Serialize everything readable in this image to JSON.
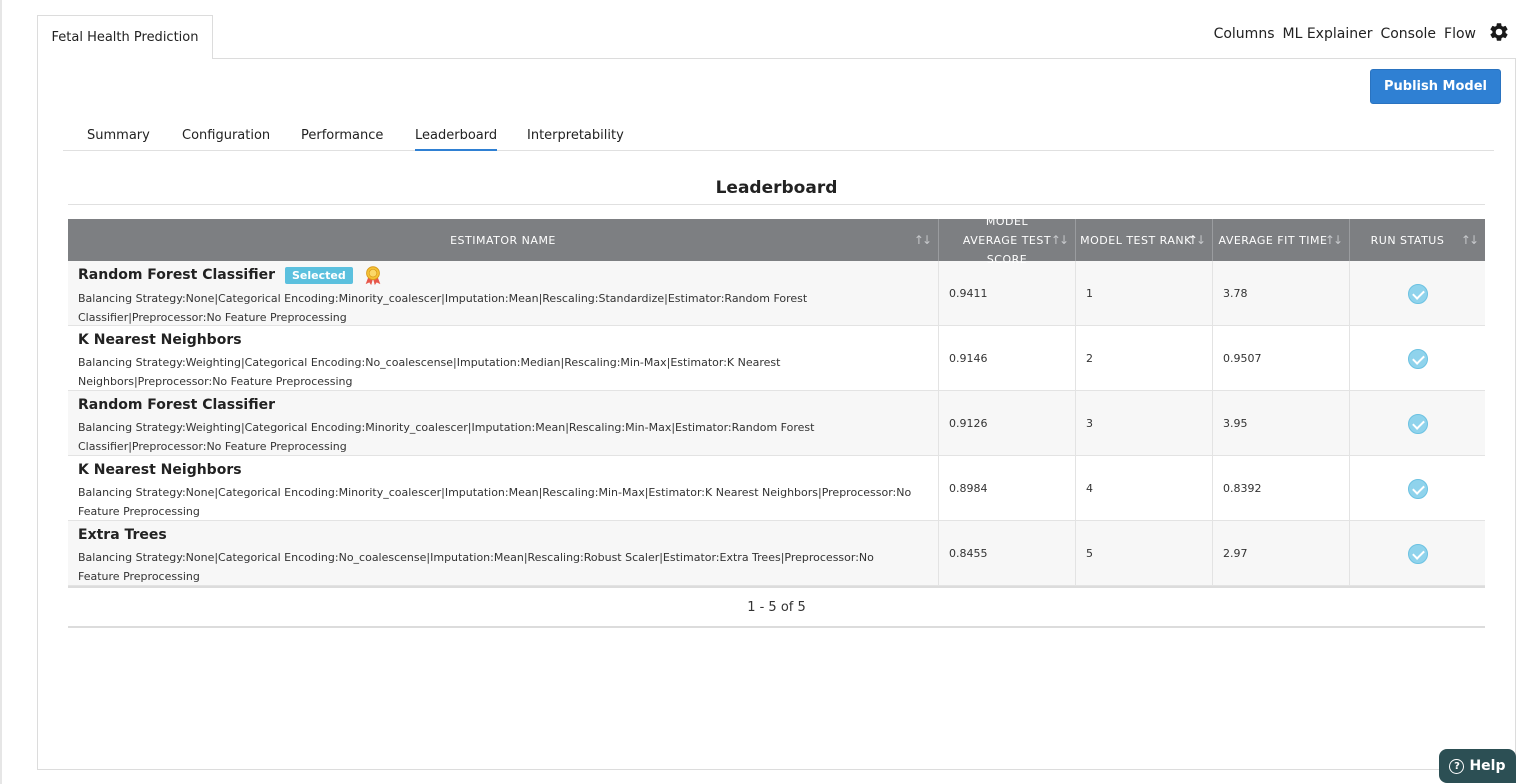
{
  "app": {
    "doc_tab": "Fetal Health Prediction",
    "top_menu": [
      "Columns",
      "ML Explainer",
      "Console",
      "Flow"
    ],
    "gear_icon": "gear-icon"
  },
  "toolbar": {
    "publish_label": "Publish Model"
  },
  "tabs": [
    {
      "label": "Summary",
      "active": false
    },
    {
      "label": "Configuration",
      "active": false
    },
    {
      "label": "Performance",
      "active": false
    },
    {
      "label": "Leaderboard",
      "active": true
    },
    {
      "label": "Interpretability",
      "active": false
    }
  ],
  "leaderboard": {
    "title": "Leaderboard",
    "columns": [
      "ESTIMATOR NAME",
      "MODEL AVERAGE TEST SCORE",
      "MODEL TEST RANK",
      "AVERAGE FIT TIME",
      "RUN STATUS"
    ],
    "selected_badge": "Selected",
    "rows": [
      {
        "name": "Random Forest Classifier",
        "selected": true,
        "description": "Balancing Strategy:None|Categorical Encoding:Minority_coalescer|Imputation:Mean|Rescaling:Standardize|Estimator:Random Forest Classifier|Preprocessor:No Feature Preprocessing",
        "score": "0.9411",
        "rank": "1",
        "fit_time": "3.78",
        "status": "completed"
      },
      {
        "name": "K Nearest Neighbors",
        "selected": false,
        "description": "Balancing Strategy:Weighting|Categorical Encoding:No_coalescense|Imputation:Median|Rescaling:Min-Max|Estimator:K Nearest Neighbors|Preprocessor:No Feature Preprocessing",
        "score": "0.9146",
        "rank": "2",
        "fit_time": "0.9507",
        "status": "completed"
      },
      {
        "name": "Random Forest Classifier",
        "selected": false,
        "description": "Balancing Strategy:Weighting|Categorical Encoding:Minority_coalescer|Imputation:Mean|Rescaling:Min-Max|Estimator:Random Forest Classifier|Preprocessor:No Feature Preprocessing",
        "score": "0.9126",
        "rank": "3",
        "fit_time": "3.95",
        "status": "completed"
      },
      {
        "name": "K Nearest Neighbors",
        "selected": false,
        "description": "Balancing Strategy:None|Categorical Encoding:Minority_coalescer|Imputation:Mean|Rescaling:Min-Max|Estimator:K Nearest Neighbors|Preprocessor:No Feature Preprocessing",
        "score": "0.8984",
        "rank": "4",
        "fit_time": "0.8392",
        "status": "completed"
      },
      {
        "name": "Extra Trees",
        "selected": false,
        "description": "Balancing Strategy:None|Categorical Encoding:No_coalescense|Imputation:Mean|Rescaling:Robust Scaler|Estimator:Extra Trees|Preprocessor:No Feature Preprocessing",
        "score": "0.8455",
        "rank": "5",
        "fit_time": "2.97",
        "status": "completed"
      }
    ],
    "pager_text": "1 - 5 of 5"
  },
  "help": {
    "label": "Help"
  },
  "colors": {
    "accent": "#2f80d3",
    "header_bg": "#7d7f82",
    "badge": "#5bc0de",
    "help_bg": "#2c4f54"
  }
}
